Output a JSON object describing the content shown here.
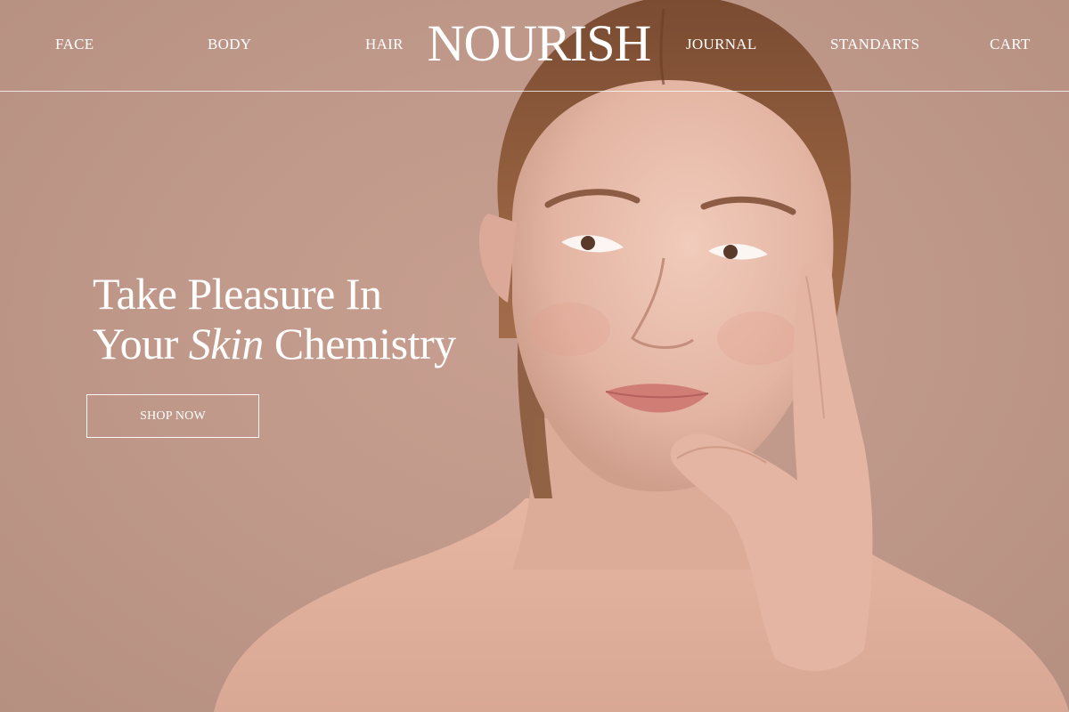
{
  "brand": {
    "name": "NOURISH"
  },
  "nav": {
    "face": "FACE",
    "body": "BODY",
    "hair": "HAIR",
    "journal": "JOURNAL",
    "standarts": "STANDARTS",
    "cart": "CART"
  },
  "hero": {
    "line1": "Take Pleasure In",
    "line2_before": "Your ",
    "line2_em": "Skin",
    "line2_after": " Chemistry",
    "cta": "SHOP NOW"
  },
  "colors": {
    "background": "#c0998a",
    "text": "#ffffff",
    "skin": "#e8bfae",
    "hair": "#8a5a3c"
  }
}
